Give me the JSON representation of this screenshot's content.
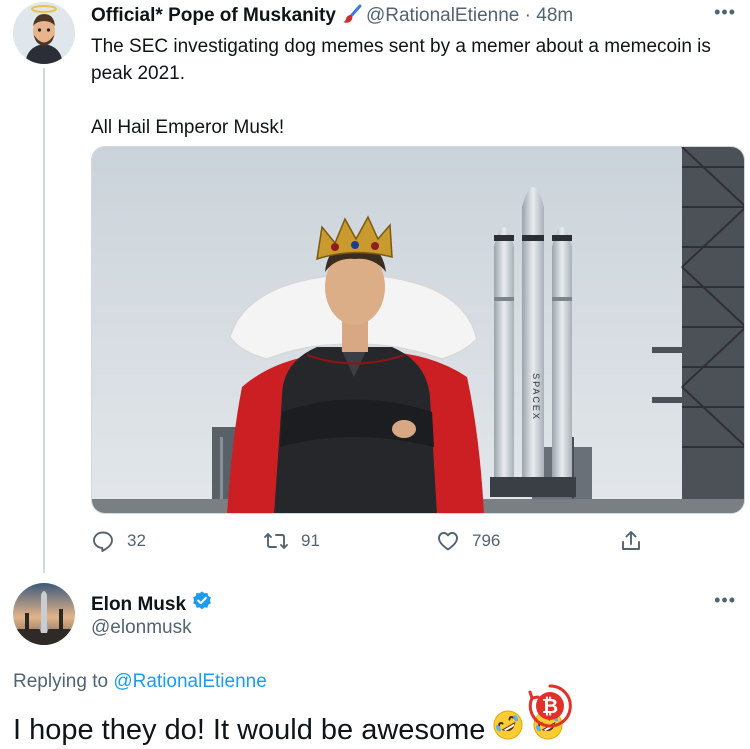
{
  "parent_tweet": {
    "author_name": "Official* Pope of Muskanity",
    "author_handle": "@RationalEtienne",
    "separator": "·",
    "time": "48m",
    "more_icon": "more-dots-icon",
    "text_line1": "The SEC investigating dog memes sent by a memer about a memecoin is peak 2021.",
    "text_line2": "All Hail Emperor Musk!",
    "media_icon_names": [
      "crown",
      "royal-cape",
      "rocket",
      "launch-tower"
    ],
    "media_rocket_lettering": "SPACEX",
    "actions": {
      "replies": "32",
      "retweets": "91",
      "likes": "796"
    }
  },
  "reply_tweet": {
    "author_name": "Elon Musk",
    "author_handle": "@elonmusk",
    "verified": true,
    "replying_prefix": "Replying to",
    "replying_handle": "@RationalEtienne",
    "text": "I hope they do! It would be awesome",
    "emoji": [
      "rolling-on-floor-laughing-emoji",
      "rolling-on-floor-laughing-emoji"
    ]
  },
  "colors": {
    "link_blue": "#1d9bf0",
    "secondary_text": "#536471",
    "verified_blue": "#1d9bf0",
    "bitcoin_badge_red": "#e0312b"
  }
}
